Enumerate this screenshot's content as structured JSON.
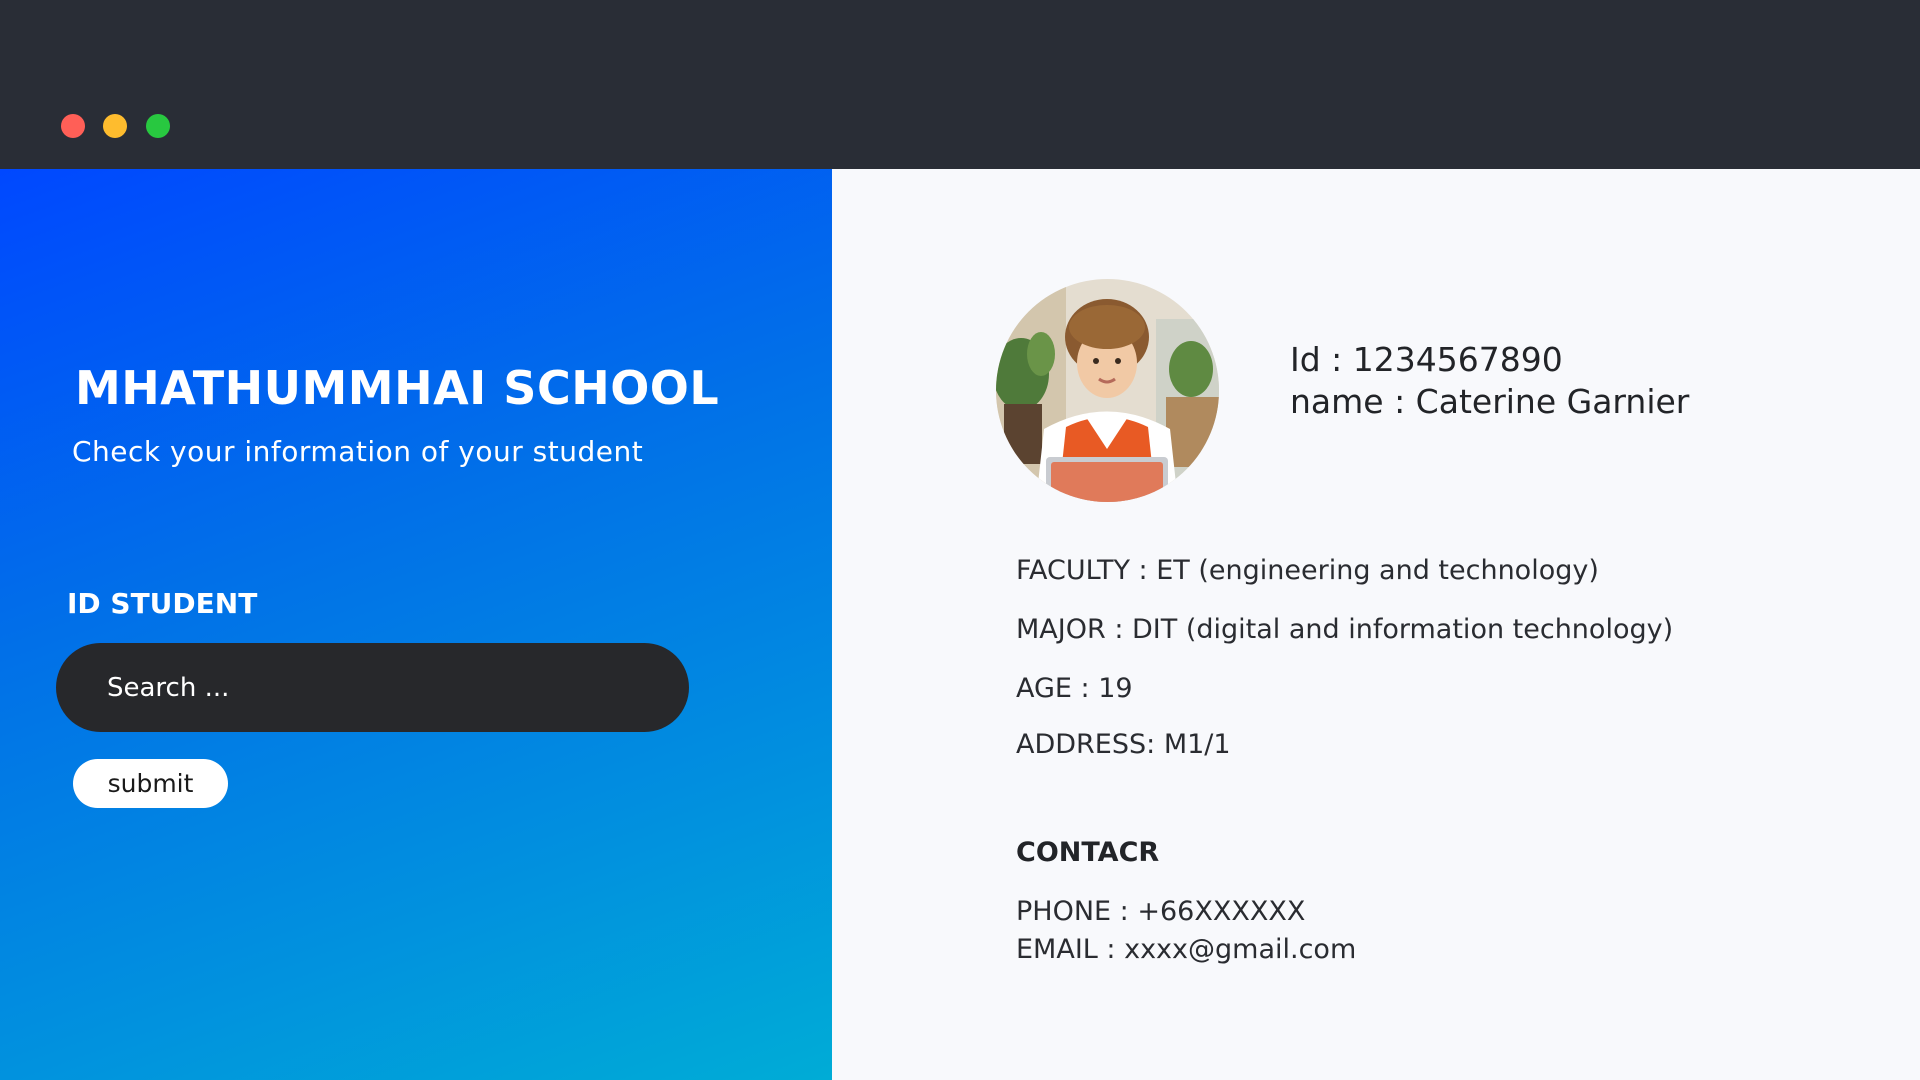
{
  "window": {
    "controls": [
      "close",
      "minimize",
      "maximize"
    ],
    "colors": {
      "close": "#ff5f57",
      "minimize": "#febc2e",
      "maximize": "#28c840",
      "titlebar": "#292d36"
    }
  },
  "left": {
    "title": "MHATHUMMHAI SCHOOL",
    "subtitle": "Check your information of your student",
    "id_label": "ID STUDENT",
    "search_placeholder": "Search ...",
    "submit_label": "submit",
    "gradient_colors": [
      "#0048ff",
      "#00acd6"
    ]
  },
  "profile": {
    "avatar_icon": "student-photo",
    "id_line": "Id : 1234567890",
    "name_line": "name : Caterine Garnier",
    "faculty": "FACULTY : ET (engineering and technology)",
    "major": "MAJOR : DIT (digital and information technology)",
    "age": "AGE : 19",
    "address": "ADDRESS: M1/1",
    "contact_title": "CONTACR",
    "phone": "PHONE : +66XXXXXX",
    "email": "EMAIL : xxxx@gmail.com"
  }
}
